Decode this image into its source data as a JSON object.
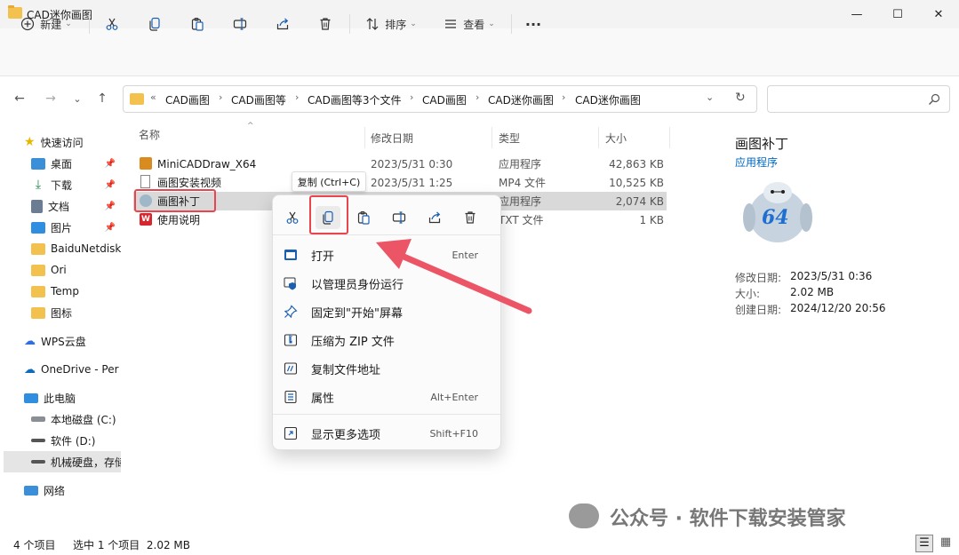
{
  "window": {
    "title": "CAD迷你画图",
    "minimize": "—",
    "maximize": "☐",
    "close": "✕"
  },
  "toolbar": {
    "new_label": "新建",
    "sort_label": "排序",
    "view_label": "查看",
    "more": "···"
  },
  "nav": {
    "back": "←",
    "forward": "→",
    "recent": "⌄",
    "up": "↑",
    "refresh": "↻",
    "dropdown": "⌄"
  },
  "breadcrumb": {
    "overflow": "«",
    "items": [
      "CAD画图",
      "CAD画图等",
      "CAD画图等3个文件",
      "CAD画图",
      "CAD迷你画图",
      "CAD迷你画图"
    ],
    "sep": "›"
  },
  "sidebar": {
    "items": [
      {
        "label": "快速访问"
      },
      {
        "label": "桌面"
      },
      {
        "label": "下载"
      },
      {
        "label": "文档"
      },
      {
        "label": "图片"
      },
      {
        "label": "BaiduNetdisk"
      },
      {
        "label": "Ori"
      },
      {
        "label": "Temp"
      },
      {
        "label": "图标"
      },
      {
        "label": "WPS云盘"
      },
      {
        "label": "OneDrive - Per"
      },
      {
        "label": "此电脑"
      },
      {
        "label": "本地磁盘 (C:)"
      },
      {
        "label": "软件 (D:)"
      },
      {
        "label": "机械硬盘，存储"
      },
      {
        "label": "网络"
      }
    ]
  },
  "columns": {
    "name": "名称",
    "date": "修改日期",
    "type": "类型",
    "size": "大小"
  },
  "files": [
    {
      "name": "MiniCADDraw_X64",
      "date": "2023/5/31 0:30",
      "type": "应用程序",
      "size": "42,863 KB"
    },
    {
      "name": "画图安装视频",
      "date": "2023/5/31 1:25",
      "type": "MP4 文件",
      "size": "10,525 KB"
    },
    {
      "name": "画图补丁",
      "date": "",
      "type": "应用程序",
      "size": "2,074 KB"
    },
    {
      "name": "使用说明",
      "date": "",
      "type": "TXT 文件",
      "size": "1 KB"
    }
  ],
  "tooltip": "复制 (Ctrl+C)",
  "context_menu": {
    "items": [
      {
        "label": "打开",
        "key": "Enter"
      },
      {
        "label": "以管理员身份运行",
        "key": ""
      },
      {
        "label": "固定到\"开始\"屏幕",
        "key": ""
      },
      {
        "label": "压缩为 ZIP 文件",
        "key": ""
      },
      {
        "label": "复制文件地址",
        "key": ""
      },
      {
        "label": "属性",
        "key": "Alt+Enter"
      },
      {
        "label": "显示更多选项",
        "key": "Shift+F10"
      }
    ]
  },
  "preview": {
    "title": "画图补丁",
    "subtitle": "应用程序",
    "badge": "64",
    "details": [
      {
        "label": "修改日期:",
        "value": "2023/5/31 0:36"
      },
      {
        "label": "大小:",
        "value": "2.02 MB"
      },
      {
        "label": "创建日期:",
        "value": "2024/12/20 20:56"
      }
    ]
  },
  "status": {
    "count": "4 个项目",
    "selected": "选中 1 个项目  2.02 MB"
  },
  "watermark": "公众号 · 软件下载安装管家",
  "colors": {
    "accent": "#0067c0",
    "highlight": "#e8454f",
    "folder": "#f2c14e"
  }
}
